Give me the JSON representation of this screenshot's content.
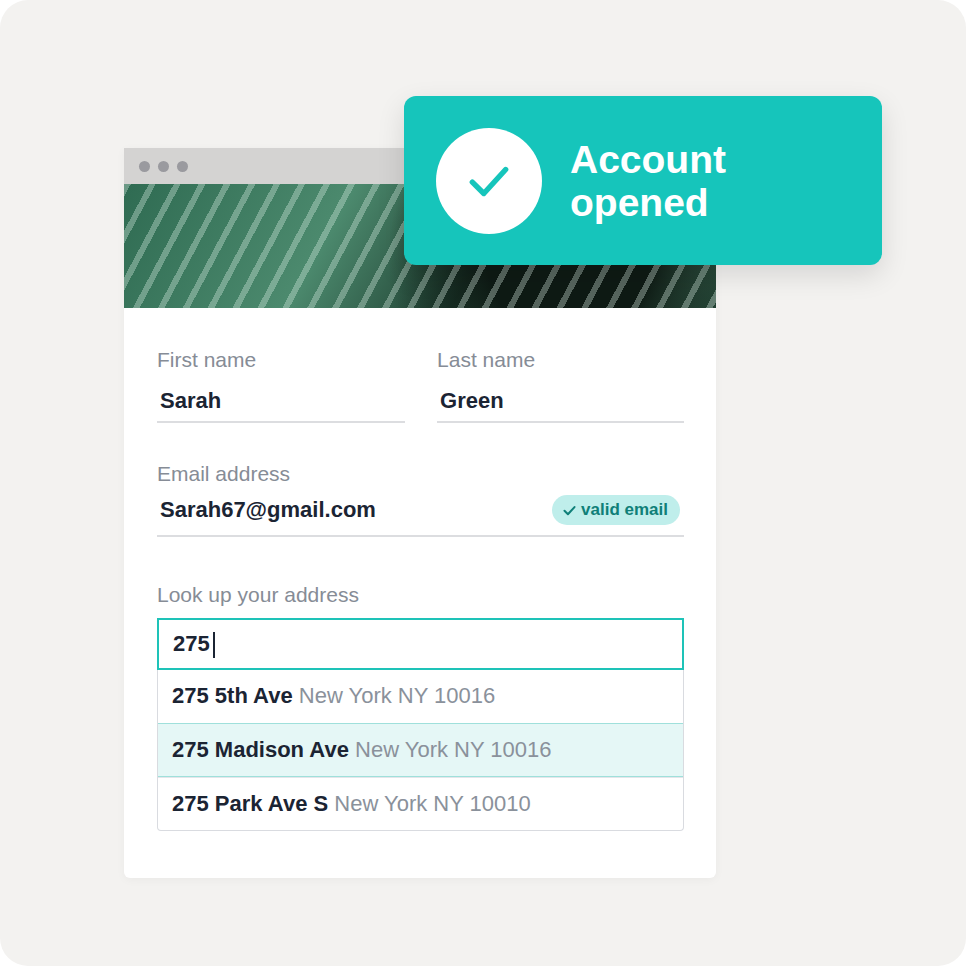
{
  "toast": {
    "title": "Account opened"
  },
  "form": {
    "first_name": {
      "label": "First name",
      "value": "Sarah"
    },
    "last_name": {
      "label": "Last name",
      "value": "Green"
    },
    "email": {
      "label": "Email address",
      "value": "Sarah67@gmail.com",
      "badge": "valid email",
      "valid": true
    },
    "address": {
      "label": "Look up your address",
      "value": "275",
      "focused": true,
      "suggestions": [
        {
          "street": "275 5th Ave",
          "city": "New York NY 10016",
          "selected": false
        },
        {
          "street": "275 Madison Ave",
          "city": "New York NY 10016",
          "selected": true
        },
        {
          "street": "275 Park Ave S",
          "city": "New York NY 10010",
          "selected": false
        }
      ]
    }
  }
}
